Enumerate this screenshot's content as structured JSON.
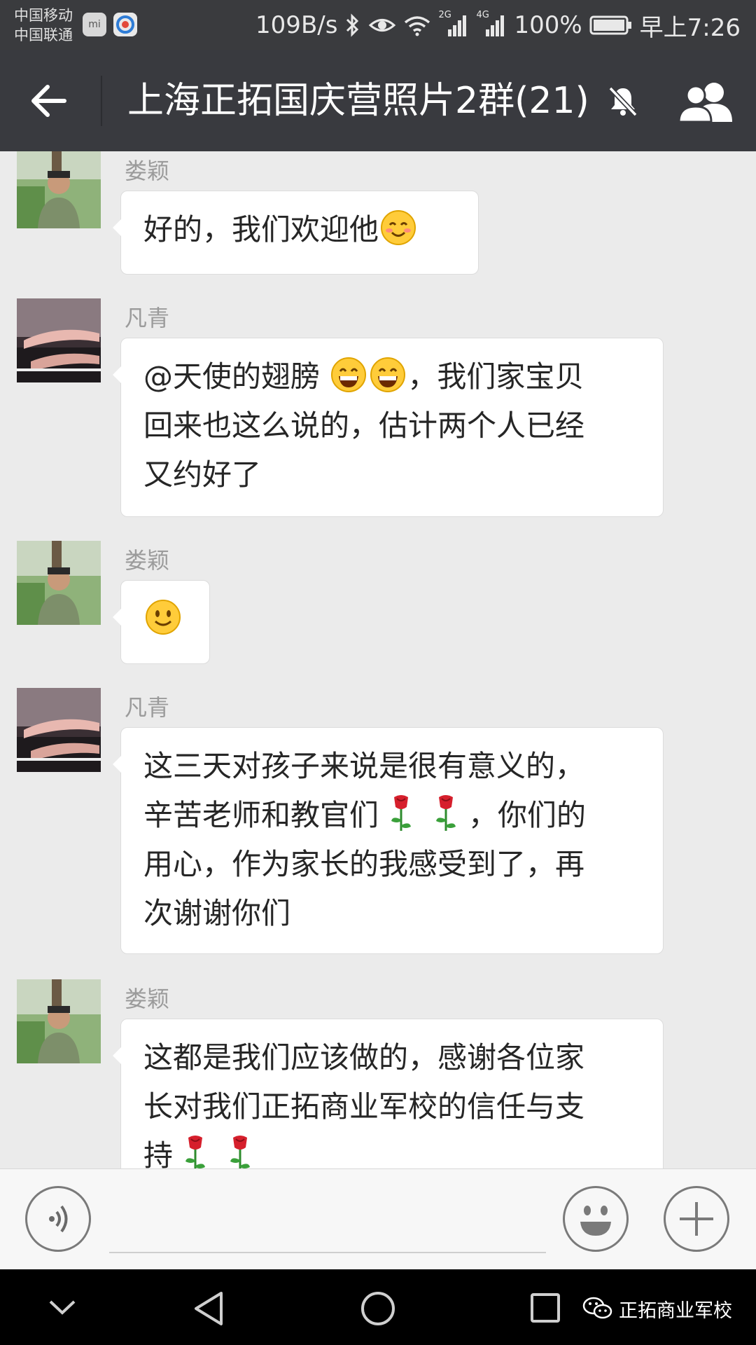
{
  "status_bar": {
    "carrier_1": "中国移动",
    "carrier_2": "中国联通",
    "app_icon_1": "mi",
    "net_speed": "109B/s",
    "signal_2g": "2G",
    "signal_4g": "4G",
    "battery": "100%",
    "time": "早上7:26"
  },
  "header": {
    "title": "上海正拓国庆营照片2群(21)",
    "back_icon": "arrow-left-icon",
    "mute_icon": "bell-off-icon",
    "members_icon": "group-members-icon"
  },
  "messages": [
    {
      "sender": "娄颖",
      "avatar": "soldier-avatar",
      "parts": [
        {
          "text": "好的，我们欢迎他"
        },
        {
          "emoji": "blush-smile"
        }
      ]
    },
    {
      "sender": "凡青",
      "avatar": "piano-hands-avatar",
      "lines": [
        [
          {
            "text": "@天使的翅膀 "
          },
          {
            "emoji": "grin"
          },
          {
            "emoji": "grin"
          },
          {
            "text": "，我们家宝贝"
          }
        ],
        [
          {
            "text": "回来也这么说的，估计两个人已经"
          }
        ],
        [
          {
            "text": "又约好了"
          }
        ]
      ]
    },
    {
      "sender": "娄颖",
      "avatar": "soldier-avatar",
      "parts": [
        {
          "emoji": "smile"
        }
      ]
    },
    {
      "sender": "凡青",
      "avatar": "piano-hands-avatar",
      "lines": [
        [
          {
            "text": "这三天对孩子来说是很有意义的，"
          }
        ],
        [
          {
            "text": "辛苦老师和教官们"
          },
          {
            "emoji": "rose"
          },
          {
            "emoji": "rose"
          },
          {
            "text": "，你们的"
          }
        ],
        [
          {
            "text": "用心，作为家长的我感受到了，再"
          }
        ],
        [
          {
            "text": "次谢谢你们"
          }
        ]
      ]
    },
    {
      "sender": "娄颖",
      "avatar": "soldier-avatar",
      "lines": [
        [
          {
            "text": "这都是我们应该做的，感谢各位家"
          }
        ],
        [
          {
            "text": "长对我们正拓商业军校的信任与支"
          }
        ],
        [
          {
            "text": "持"
          },
          {
            "emoji": "rose"
          },
          {
            "emoji": "rose"
          }
        ]
      ]
    }
  ],
  "input_bar": {
    "voice_icon": "voice-input-icon",
    "emoji_icon": "emoji-face-icon",
    "plus_icon": "plus-icon"
  },
  "nav_bar": {
    "watermark": "正拓商业军校",
    "watermark_icon": "wechat-logo-icon"
  },
  "colors": {
    "header_bg": "#393a3f",
    "chat_bg": "#ebebeb",
    "bubble_bg": "#ffffff",
    "sender_gray": "#9b9b9b"
  }
}
